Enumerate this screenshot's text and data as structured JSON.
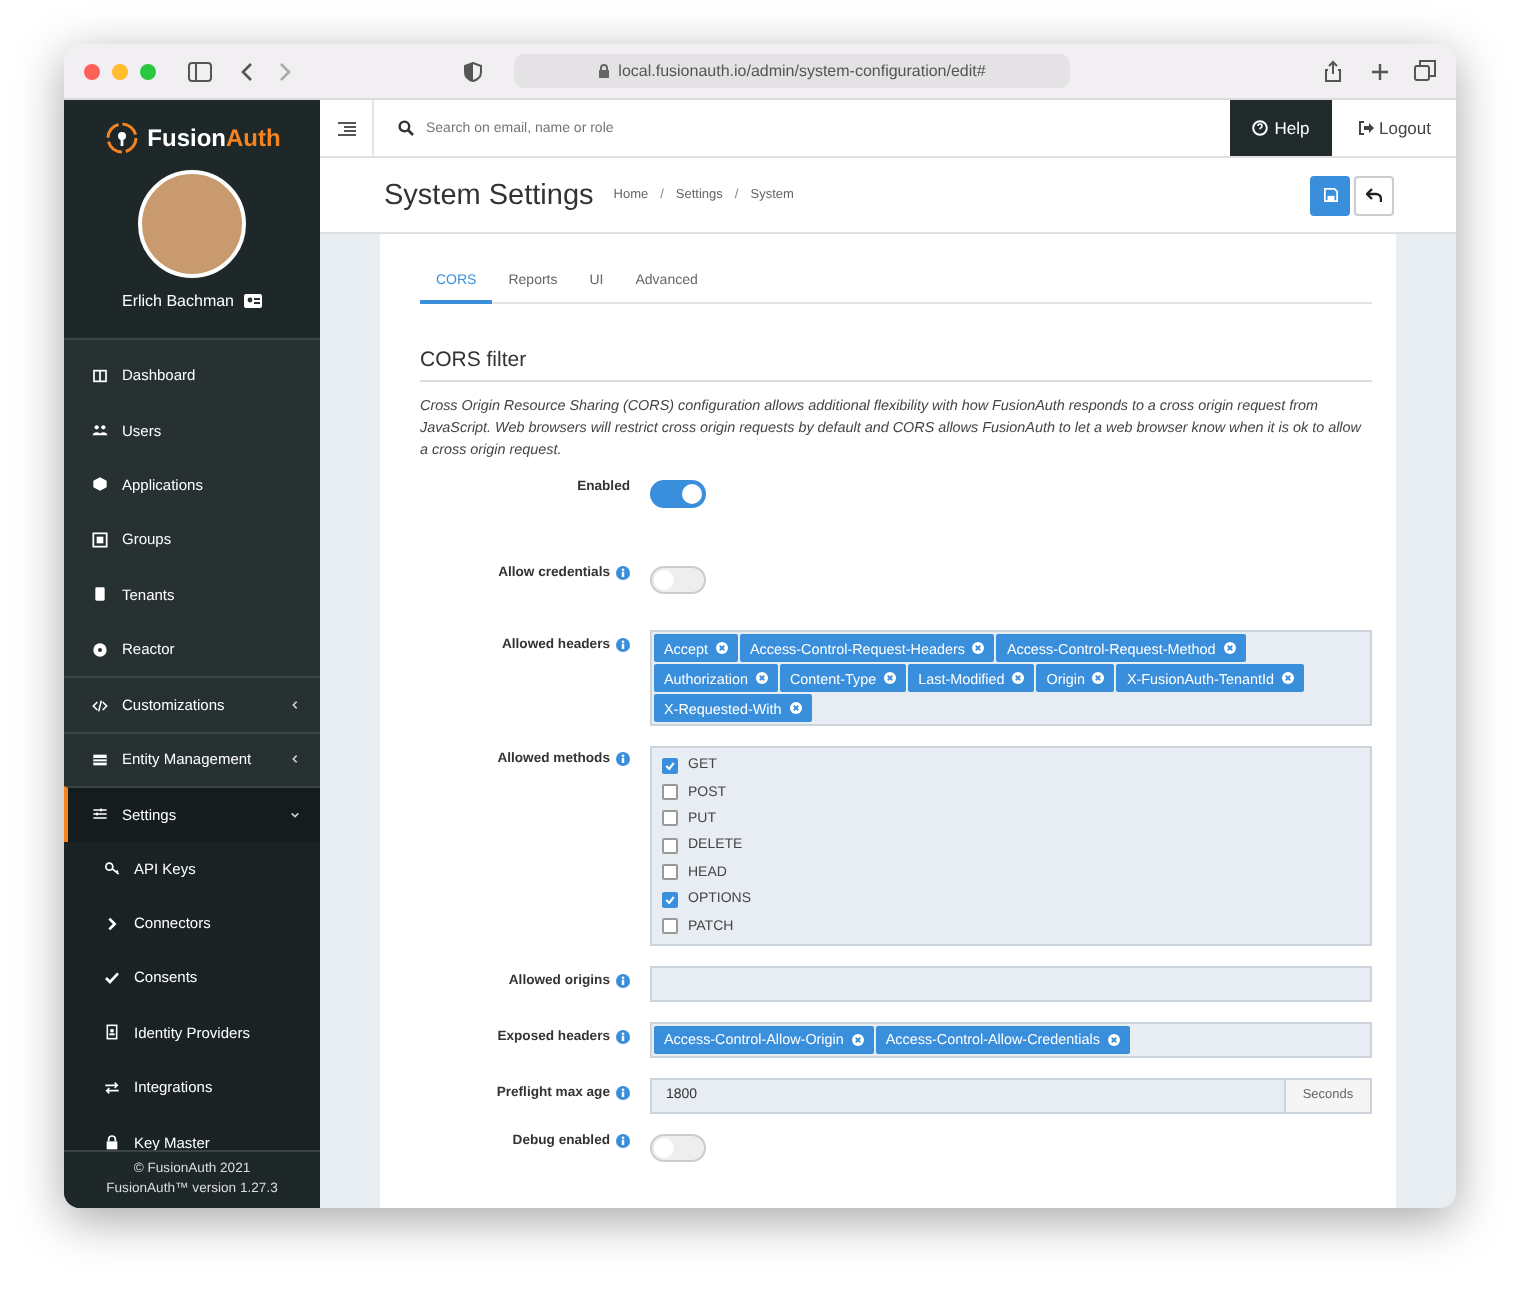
{
  "browser": {
    "url": "local.fusionauth.io/admin/system-configuration/edit#"
  },
  "sidebar": {
    "brand": {
      "first": "Fusion",
      "second": "Auth"
    },
    "user_name": "Erlich Bachman",
    "items": [
      {
        "label": "Dashboard",
        "kind": "item",
        "selected": false
      },
      {
        "label": "Users",
        "kind": "item",
        "selected": false
      },
      {
        "label": "Applications",
        "kind": "item",
        "selected": false
      },
      {
        "label": "Groups",
        "kind": "item",
        "selected": false
      },
      {
        "label": "Tenants",
        "kind": "item",
        "selected": false
      },
      {
        "label": "Reactor",
        "kind": "item",
        "selected": false
      },
      {
        "label": "Customizations",
        "kind": "group",
        "selected": false,
        "expanded": false
      },
      {
        "label": "Entity Management",
        "kind": "group",
        "selected": false,
        "expanded": false
      },
      {
        "label": "Settings",
        "kind": "group",
        "selected": true,
        "expanded": true,
        "children": [
          {
            "label": "API Keys",
            "selected": false
          },
          {
            "label": "Connectors",
            "selected": false
          },
          {
            "label": "Consents",
            "selected": false
          },
          {
            "label": "Identity Providers",
            "selected": false
          },
          {
            "label": "Integrations",
            "selected": false
          },
          {
            "label": "Key Master",
            "selected": false
          }
        ]
      }
    ],
    "footer": [
      "© FusionAuth 2021",
      "FusionAuth™ version 1.27.3"
    ]
  },
  "topbar": {
    "search": {
      "placeholder": "Search on email, name or role"
    },
    "help": "Help",
    "logout": "Logout"
  },
  "header": {
    "title": "System Settings",
    "breadcrumbs": [
      {
        "label": "Home"
      },
      {
        "separator": "/",
        "label": "Settings"
      },
      {
        "separator": "/",
        "label": "System"
      }
    ]
  },
  "tabs": [
    {
      "label": "CORS",
      "selected": true
    },
    {
      "label": "Reports",
      "selected": false
    },
    {
      "label": "UI",
      "selected": false
    },
    {
      "label": "Advanced",
      "selected": false
    }
  ],
  "section": {
    "title": "CORS filter",
    "description": "Cross Origin Resource Sharing (CORS) configuration allows additional flexibility with how FusionAuth responds to a cross origin request from JavaScript. Web browsers will restrict cross origin requests by default and CORS allows FusionAuth to let a web browser know when it is ok to allow a cross origin request.",
    "fields": [
      {
        "kind": "toggle",
        "label": "Enabled",
        "info": false,
        "on": true
      },
      {
        "kind": "toggle",
        "label": "Allow credentials",
        "info": true,
        "on": false
      },
      {
        "kind": "tags",
        "label": "Allowed headers",
        "info": true,
        "tags": [
          "Accept",
          "Access-Control-Request-Headers",
          "Access-Control-Request-Method",
          "Authorization",
          "Content-Type",
          "Last-Modified",
          "Origin",
          "X-FusionAuth-TenantId",
          "X-Requested-With"
        ]
      },
      {
        "kind": "checklist",
        "label": "Allowed methods",
        "info": true,
        "options": [
          {
            "label": "GET",
            "checked": true
          },
          {
            "label": "POST",
            "checked": false
          },
          {
            "label": "PUT",
            "checked": false
          },
          {
            "label": "DELETE",
            "checked": false
          },
          {
            "label": "HEAD",
            "checked": false
          },
          {
            "label": "OPTIONS",
            "checked": true
          },
          {
            "label": "PATCH",
            "checked": false
          }
        ]
      },
      {
        "kind": "tags",
        "label": "Allowed origins",
        "info": true
      },
      {
        "kind": "tags",
        "label": "Exposed headers",
        "info": true,
        "tags": [
          "Access-Control-Allow-Origin",
          "Access-Control-Allow-Credentials"
        ]
      },
      {
        "kind": "number",
        "label": "Preflight max age",
        "info": true,
        "value": "1800",
        "addon": "Seconds"
      },
      {
        "kind": "toggle",
        "label": "Debug enabled",
        "info": true,
        "on": false
      }
    ]
  }
}
